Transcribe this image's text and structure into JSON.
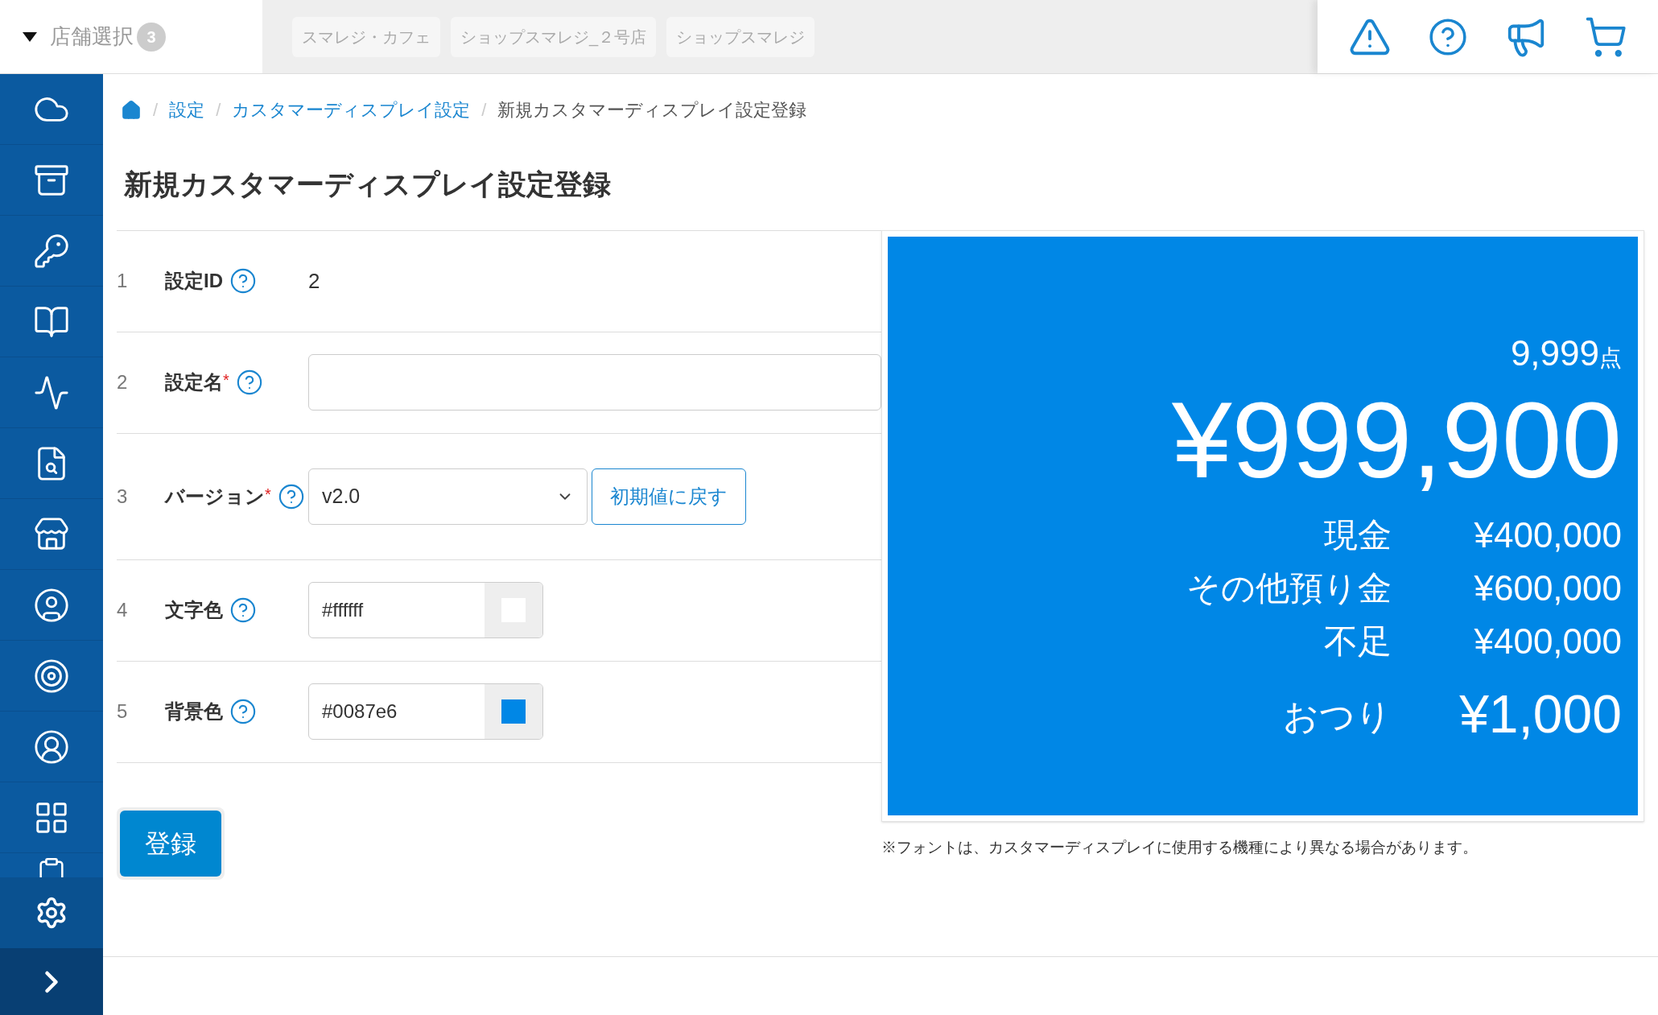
{
  "store_select": {
    "label": "店舗選択",
    "count": "3"
  },
  "store_tabs": [
    "スマレジ・カフェ",
    "ショップスマレジ_２号店",
    "ショップスマレジ"
  ],
  "breadcrumb": {
    "separator": "/",
    "links": [
      "設定",
      "カスタマーディスプレイ設定"
    ],
    "current": "新規カスタマーディスプレイ設定登録"
  },
  "page_title": "新規カスタマーディスプレイ設定登録",
  "form_rows": [
    {
      "number": "1",
      "label": "設定ID",
      "required": false,
      "kind": "static",
      "value": "2"
    },
    {
      "number": "2",
      "label": "設定名",
      "required": true,
      "kind": "text",
      "value": ""
    },
    {
      "number": "3",
      "label": "バージョン",
      "required": true,
      "kind": "select",
      "value": "v2.0",
      "button": "初期値に戻す"
    },
    {
      "number": "4",
      "label": "文字色",
      "required": false,
      "kind": "color",
      "value": "#ffffff"
    },
    {
      "number": "5",
      "label": "背景色",
      "required": false,
      "kind": "color",
      "value": "#0087e6"
    }
  ],
  "required_mark": "*",
  "submit_button": "登録",
  "preview": {
    "count": "9,999",
    "count_unit": "点",
    "total": "¥999,900",
    "lines": [
      {
        "label": "現金",
        "amount": "¥400,000",
        "emphasis": false
      },
      {
        "label": "その他預り金",
        "amount": "¥600,000",
        "emphasis": false
      },
      {
        "label": "不足",
        "amount": "¥400,000",
        "emphasis": false
      },
      {
        "label": "おつり",
        "amount": "¥1,000",
        "emphasis": true
      }
    ]
  },
  "preview_note": "※フォントは、カスタマーディスプレイに使用する機種により異なる場合があります。"
}
